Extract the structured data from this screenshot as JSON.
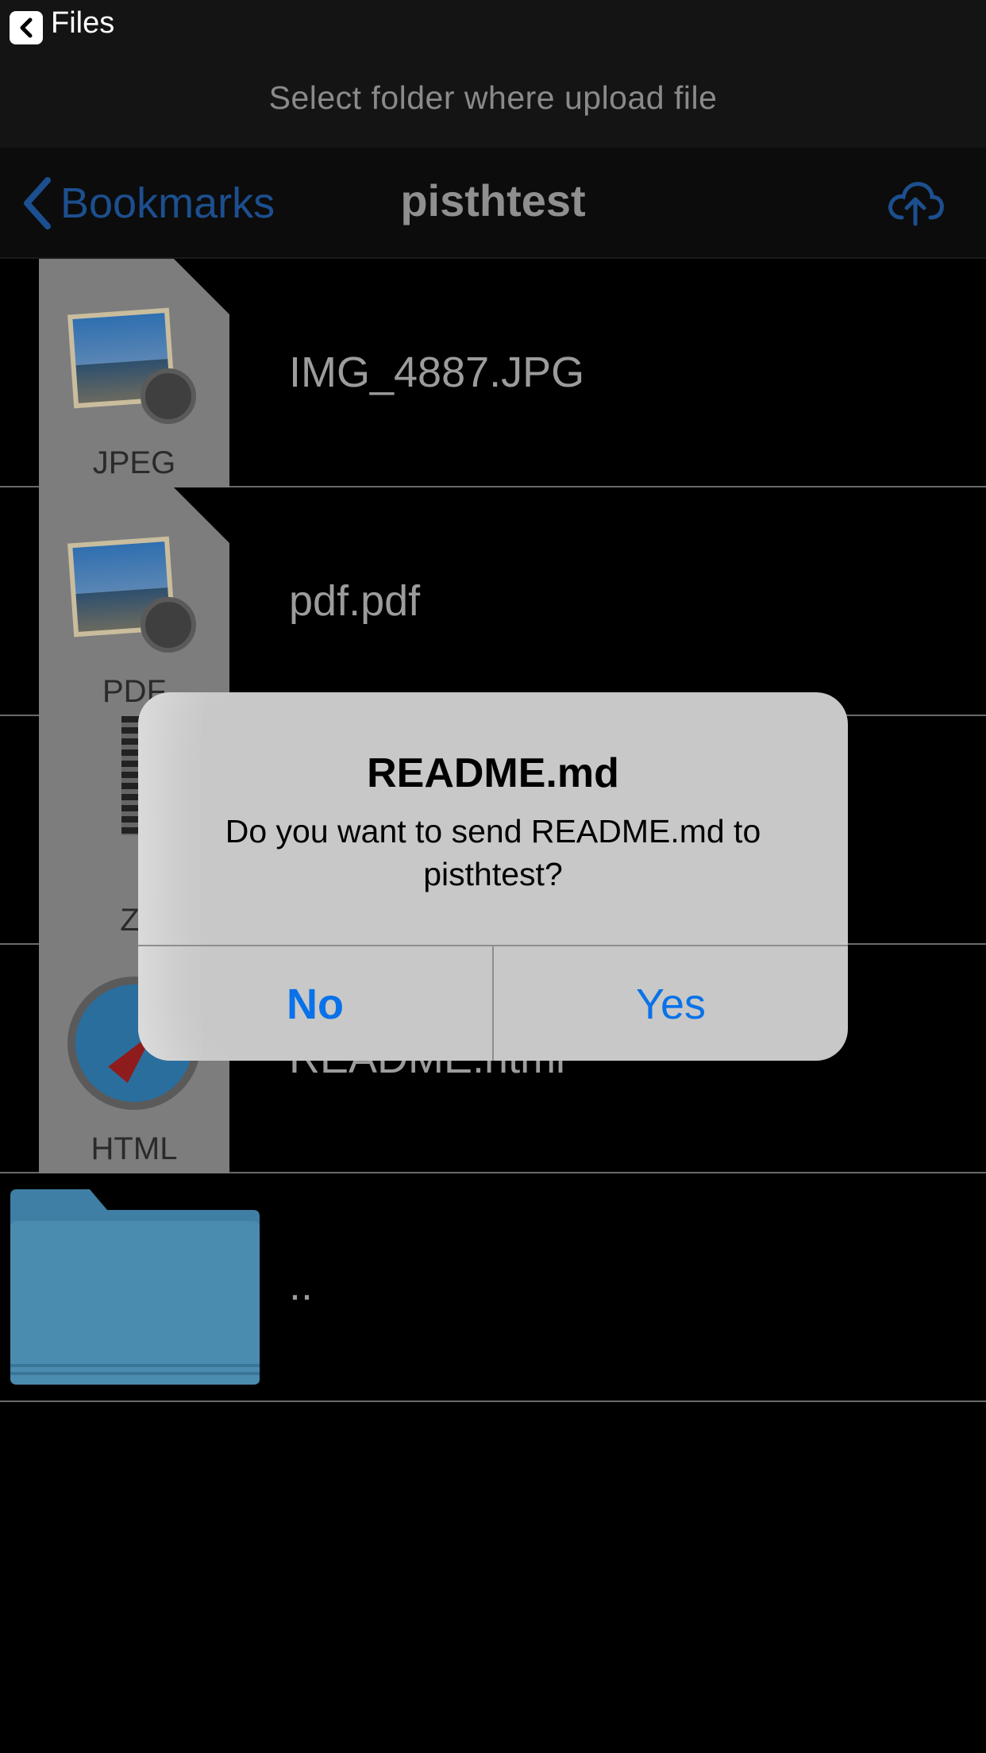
{
  "status_bar": {
    "back_app_label": "Files"
  },
  "prompt": {
    "text": "Select folder where upload file"
  },
  "navbar": {
    "back_label": "Bookmarks",
    "title": "pisthtest",
    "upload_icon": "cloud-upload-icon"
  },
  "files": [
    {
      "name": "IMG_4887.JPG",
      "type_label": "JPEG",
      "icon": "jpeg-file-icon"
    },
    {
      "name": "pdf.pdf",
      "type_label": "PDF",
      "icon": "pdf-file-icon"
    },
    {
      "name": "",
      "type_label": "ZI",
      "icon": "zip-file-icon"
    },
    {
      "name": "README.html",
      "type_label": "HTML",
      "icon": "html-file-icon"
    },
    {
      "name": "..",
      "type_label": "",
      "icon": "folder-icon"
    }
  ],
  "dialog": {
    "title": "README.md",
    "message": "Do you want to send README.md to pisthtest?",
    "no_label": "No",
    "yes_label": "Yes"
  },
  "colors": {
    "accent": "#0a72e8",
    "nav_accent": "#1c4f8f",
    "background": "#000000"
  }
}
